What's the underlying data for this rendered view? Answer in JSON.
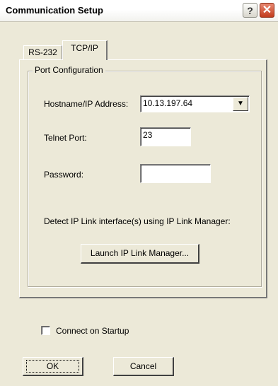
{
  "window": {
    "title": "Communication Setup",
    "help_label": "?",
    "close_label": "✕"
  },
  "tabs": [
    {
      "label": "RS-232",
      "selected": false
    },
    {
      "label": "TCP/IP",
      "selected": true
    }
  ],
  "port_config": {
    "group_label": "Port Configuration",
    "hostname_label": "Hostname/IP Address:",
    "hostname_value": "10.13.197.64",
    "telnet_label": "Telnet Port:",
    "telnet_value": "23",
    "password_label": "Password:",
    "password_value": "",
    "detect_text": "Detect IP Link interface(s) using IP Link Manager:",
    "launch_label": "Launch IP Link Manager..."
  },
  "connect_on_startup": {
    "label": "Connect on Startup",
    "checked": false
  },
  "footer": {
    "ok_label": "OK",
    "cancel_label": "Cancel"
  }
}
